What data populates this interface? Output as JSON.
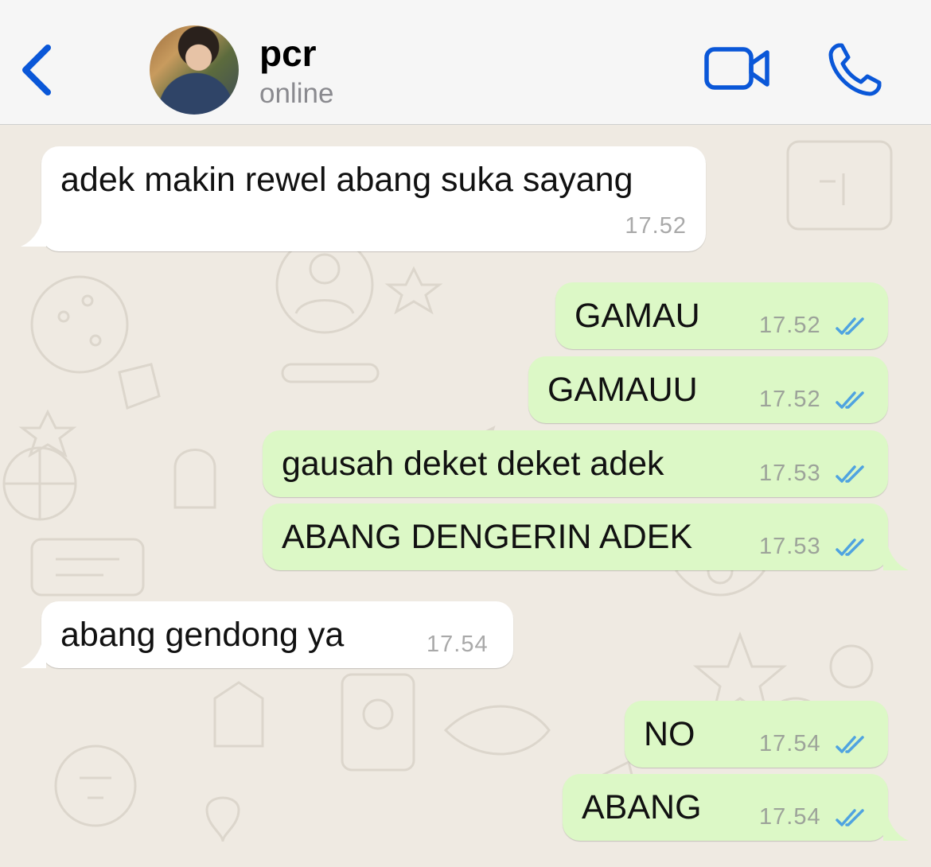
{
  "header": {
    "contact_name": "pcr",
    "status": "online",
    "back_icon": "chevron-left-icon",
    "video_icon": "video-camera-icon",
    "call_icon": "phone-icon",
    "accent_color": "#0a57d8"
  },
  "colors": {
    "incoming_bubble": "#ffffff",
    "outgoing_bubble": "#dcf8c6",
    "read_ticks": "#4fa3e0",
    "chat_background": "#efeae2"
  },
  "messages": [
    {
      "direction": "in",
      "text": "adek makin rewel abang suka sayang",
      "time": "17.52"
    },
    {
      "direction": "out",
      "text": "GAMAU",
      "time": "17.52",
      "status": "read"
    },
    {
      "direction": "out",
      "text": "GAMAUU",
      "time": "17.52",
      "status": "read"
    },
    {
      "direction": "out",
      "text": "gausah deket deket adek",
      "time": "17.53",
      "status": "read"
    },
    {
      "direction": "out",
      "text": "ABANG DENGERIN ADEK",
      "time": "17.53",
      "status": "read"
    },
    {
      "direction": "in",
      "text": "abang gendong ya",
      "time": "17.54"
    },
    {
      "direction": "out",
      "text": "NO",
      "time": "17.54",
      "status": "read"
    },
    {
      "direction": "out",
      "text": "ABANG",
      "time": "17.54",
      "status": "read"
    }
  ]
}
